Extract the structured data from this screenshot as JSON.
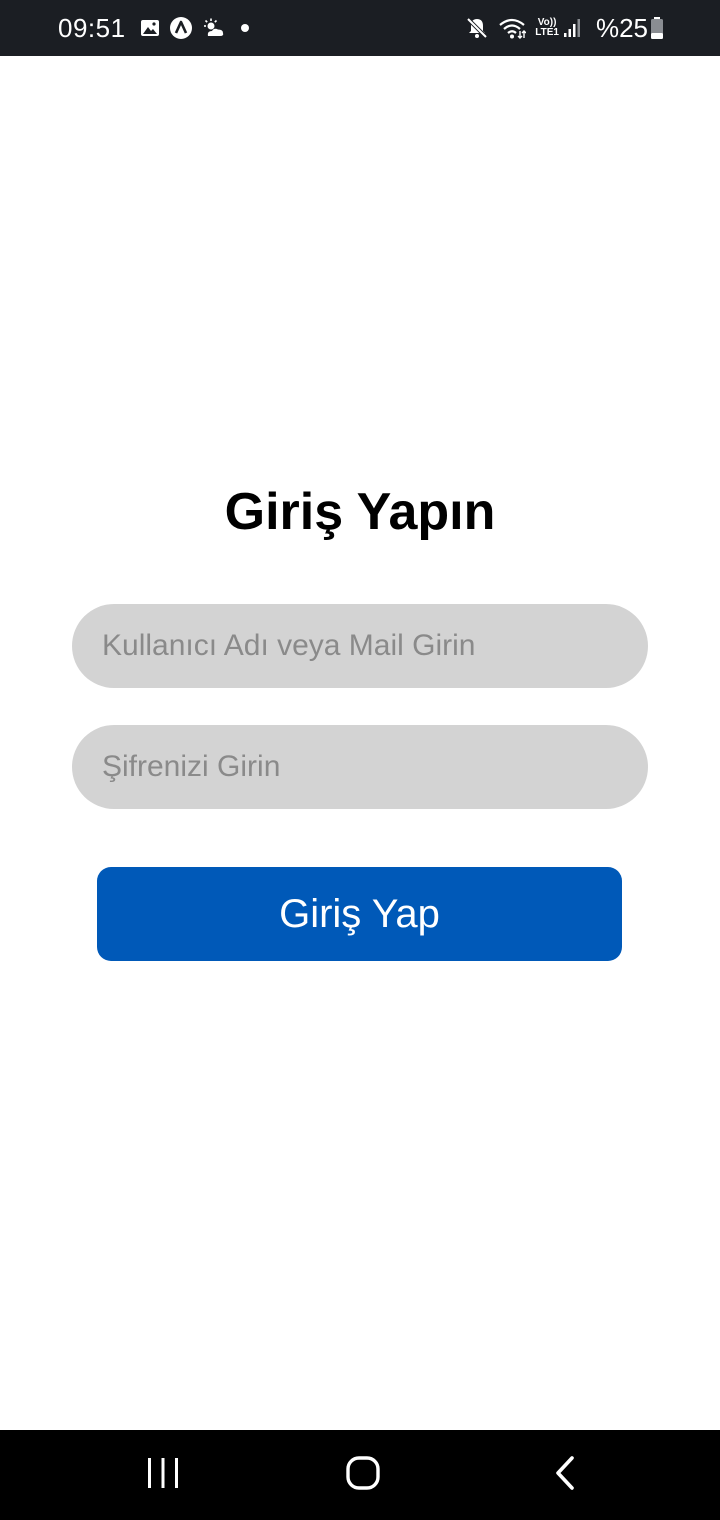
{
  "status_bar": {
    "time": "09:51",
    "battery": "%25",
    "volte_top": "Vo))",
    "volte_bottom": "LTE1",
    "icons": [
      "gallery-icon",
      "app-a-icon",
      "weather-icon",
      "notification-dot",
      "mute-icon",
      "wifi-icon",
      "volte-icon",
      "signal-icon",
      "battery-icon"
    ]
  },
  "login": {
    "title": "Giriş Yapın",
    "username_placeholder": "Kullanıcı Adı veya Mail Girin",
    "username_value": "",
    "password_placeholder": "Şifrenizi Girin",
    "password_value": "",
    "submit_label": "Giriş Yap"
  },
  "colors": {
    "status_bar_bg": "#1b1e23",
    "field_bg": "#d3d3d3",
    "placeholder": "#8a8a8a",
    "button_bg": "#0059b8",
    "button_text": "#ffffff",
    "nav_bar_bg": "#000000"
  },
  "nav_bar": {
    "icons": [
      "recents-icon",
      "home-icon",
      "back-icon"
    ]
  }
}
